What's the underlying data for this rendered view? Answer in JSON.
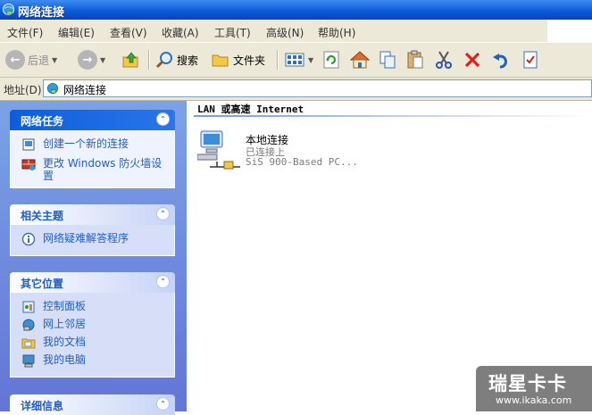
{
  "window": {
    "title": "网络连接"
  },
  "menu": [
    "文件(F)",
    "编辑(E)",
    "查看(V)",
    "收藏(A)",
    "工具(T)",
    "高级(N)",
    "帮助(H)"
  ],
  "toolbar": {
    "back": "后退",
    "search": "搜索",
    "folders": "文件夹"
  },
  "address": {
    "label": "地址(D)",
    "value": "网络连接"
  },
  "tasks": {
    "network_tasks": {
      "title": "网络任务",
      "items": [
        "创建一个新的连接",
        "更改 Windows 防火墙设置"
      ]
    },
    "related": {
      "title": "相关主题",
      "items": [
        "网络疑难解答程序"
      ]
    },
    "other_places": {
      "title": "其它位置",
      "items": [
        "控制面板",
        "网上邻居",
        "我的文档",
        "我的电脑"
      ]
    },
    "details": {
      "title": "详细信息"
    }
  },
  "content": {
    "group_header": "LAN 或高速 Internet",
    "connection": {
      "name": "本地连接",
      "status": "已连接上",
      "device": "SiS 900-Based PC..."
    }
  },
  "watermark": {
    "brand": "瑞星卡卡",
    "url": "www.ikaka.com"
  },
  "colors": {
    "titlebar": "#0a58d6",
    "taskpane": "#6375d6",
    "link": "#215dc6"
  }
}
